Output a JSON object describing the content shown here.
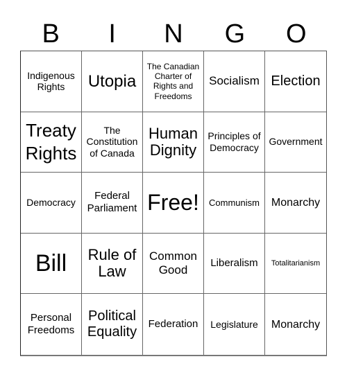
{
  "header": {
    "letters": [
      "B",
      "I",
      "N",
      "G",
      "O"
    ]
  },
  "grid": {
    "rows": [
      [
        "Indigenous Rights",
        "Utopia",
        "The Canadian Charter of Rights and Freedoms",
        "Socialism",
        "Election"
      ],
      [
        "Treaty Rights",
        "The Constitution of Canada",
        "Human Dignity",
        "Principles of Democracy",
        "Government"
      ],
      [
        "Democracy",
        "Federal Parliament",
        "Free!",
        "Communism",
        "Monarchy"
      ],
      [
        "Bill",
        "Rule of Law",
        "Common Good",
        "Liberalism",
        "Totalitarianism"
      ],
      [
        "Personal Freedoms",
        "Political Equality",
        "Federation",
        "Legislature",
        "Monarchy"
      ]
    ]
  }
}
